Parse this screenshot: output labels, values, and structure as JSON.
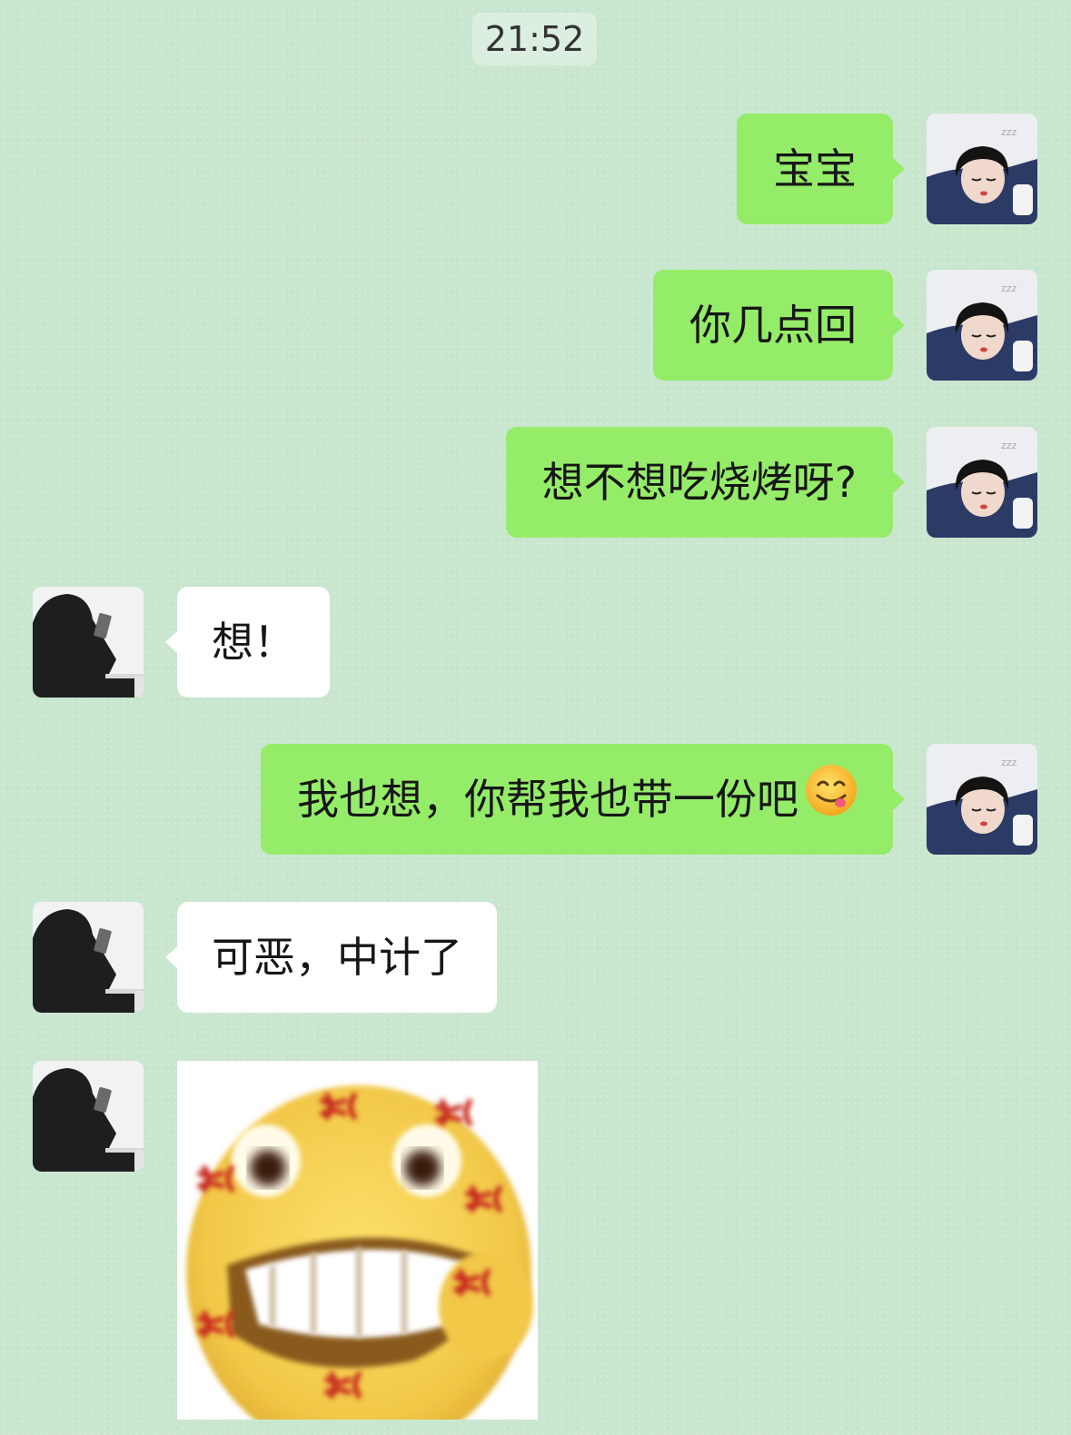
{
  "timestamp": "21:52",
  "messages": [
    {
      "side": "me",
      "text": "宝宝"
    },
    {
      "side": "me",
      "text": "你几点回"
    },
    {
      "side": "me",
      "text": "想不想吃烧烤呀?"
    },
    {
      "side": "other",
      "text": "想！"
    },
    {
      "side": "me",
      "text": "我也想，你帮我也带一份吧",
      "emoji": "yum-face-emoji"
    },
    {
      "side": "other",
      "text": "可恶，中计了"
    },
    {
      "side": "other",
      "sticker": "angry-grin-sticker"
    }
  ],
  "colors": {
    "background": "#c9e6cf",
    "my_bubble": "#95ec69",
    "their_bubble": "#ffffff",
    "sticker_face": "#f2c848",
    "anger_mark": "#c7291f"
  }
}
